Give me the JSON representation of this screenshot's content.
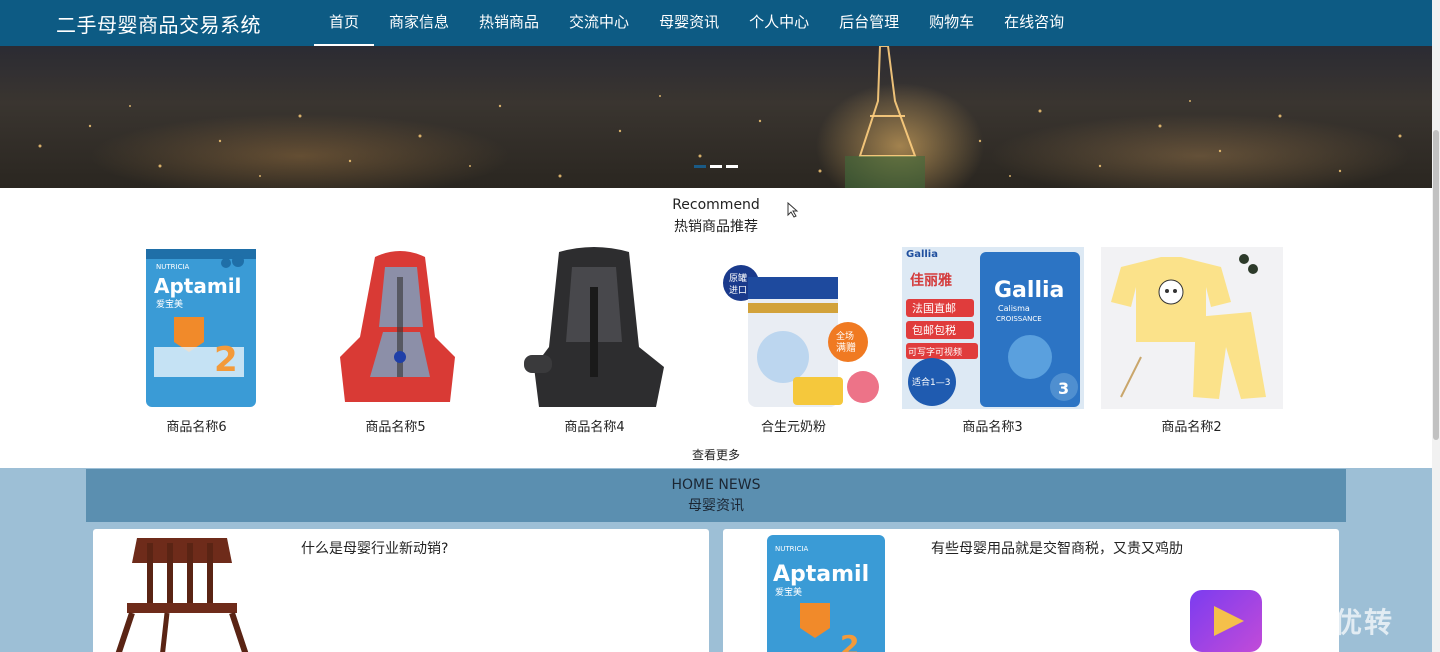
{
  "brand": "二手母婴商品交易系统",
  "nav": [
    {
      "label": "首页"
    },
    {
      "label": "商家信息"
    },
    {
      "label": "热销商品"
    },
    {
      "label": "交流中心"
    },
    {
      "label": "母婴资讯"
    },
    {
      "label": "个人中心"
    },
    {
      "label": "后台管理"
    },
    {
      "label": "购物车"
    },
    {
      "label": "在线咨询"
    }
  ],
  "recommend": {
    "title_en": "Recommend",
    "title_cn": "热销商品推荐",
    "more": "查看更多",
    "products": [
      {
        "name": "商品名称6"
      },
      {
        "name": "商品名称5"
      },
      {
        "name": "商品名称4"
      },
      {
        "name": "合生元奶粉"
      },
      {
        "name": "商品名称3"
      },
      {
        "name": "商品名称2"
      }
    ]
  },
  "news": {
    "title_en": "HOME NEWS",
    "title_cn": "母婴资讯",
    "items": [
      {
        "title": "什么是母婴行业新动销?"
      },
      {
        "title": "有些母婴用品就是交智商税，又贵又鸡肋"
      }
    ]
  },
  "product_labels": {
    "aptamil": "Aptamil",
    "aptamil_cn": "爱宝美",
    "aptamil_stage": "2",
    "nutricia": "NUTRICIA",
    "biostime_tag": "原罐进口",
    "biostime_badge": "全场满赠",
    "gallia_cn": "佳丽雅",
    "gallia": "Gallia",
    "gallia_sub": "Calisma CROISSANCE",
    "gallia_tag1": "法国直邮",
    "gallia_tag2": "包邮包税",
    "gallia_tag3": "可写字可视频",
    "gallia_age": "适合1—3",
    "gallia_stage": "3"
  },
  "watermark": "万兴优转",
  "colors": {
    "nav_bg": "#0d5b84",
    "news_head_bg": "#5b8fb0",
    "page_bg": "#9dbfd6"
  }
}
